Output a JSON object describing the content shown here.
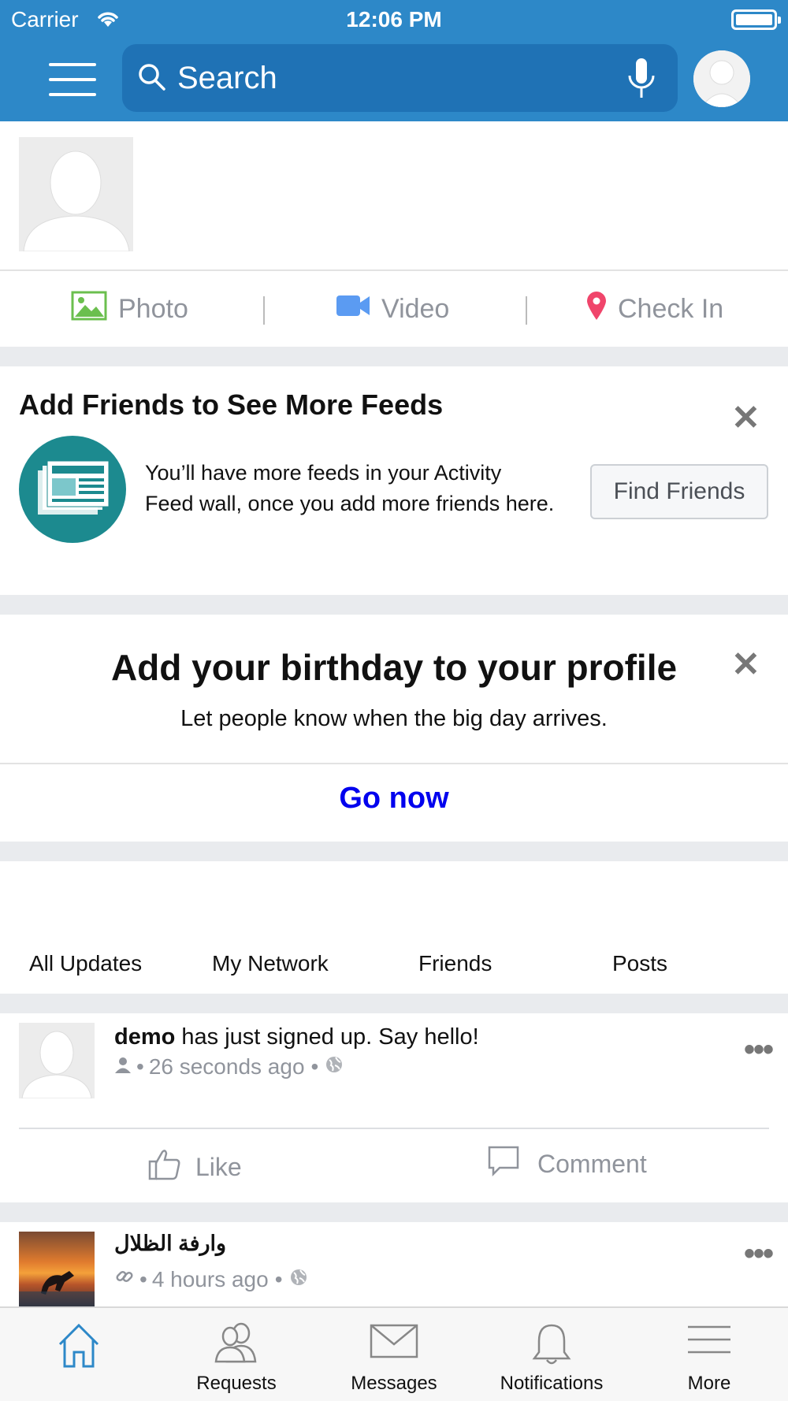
{
  "status_bar": {
    "carrier": "Carrier",
    "time": "12:06 PM"
  },
  "search": {
    "placeholder": "Search"
  },
  "composer": {
    "actions": [
      {
        "label": "Photo",
        "icon": "photo-icon",
        "color": "#6bbf4e"
      },
      {
        "label": "Video",
        "icon": "video-camera-icon",
        "color": "#5b9bf2"
      },
      {
        "label": "Check In",
        "icon": "map-pin-icon",
        "color": "#f0456b"
      }
    ]
  },
  "friends_card": {
    "title": "Add Friends to See More Feeds",
    "description": "You’ll have more feeds in your Activity Feed wall, once you add more friends here.",
    "button": "Find Friends"
  },
  "birthday_card": {
    "title": "Add your birthday to your profile",
    "subtitle": "Let people know when the big day arrives.",
    "link": "Go now"
  },
  "feed_tabs": [
    "All Updates",
    "My Network",
    "Friends",
    "Posts"
  ],
  "posts": [
    {
      "user": "demo",
      "text": " has just signed up. Say hello!",
      "time": "26 seconds ago",
      "like_label": "Like",
      "comment_label": "Comment"
    },
    {
      "user": "وارفة الظلال",
      "time": "4 hours ago"
    }
  ],
  "tabbar": [
    {
      "label": "",
      "icon": "home-icon",
      "active": true
    },
    {
      "label": "Requests",
      "icon": "friends-icon"
    },
    {
      "label": "Messages",
      "icon": "envelope-icon"
    },
    {
      "label": "Notifications",
      "icon": "bell-icon"
    },
    {
      "label": "More",
      "icon": "menu-icon"
    }
  ],
  "colors": {
    "header": "#2d88c8",
    "search_bg": "#1f72b5",
    "link": "#0000ee",
    "active_tab": "#2d88c8"
  }
}
